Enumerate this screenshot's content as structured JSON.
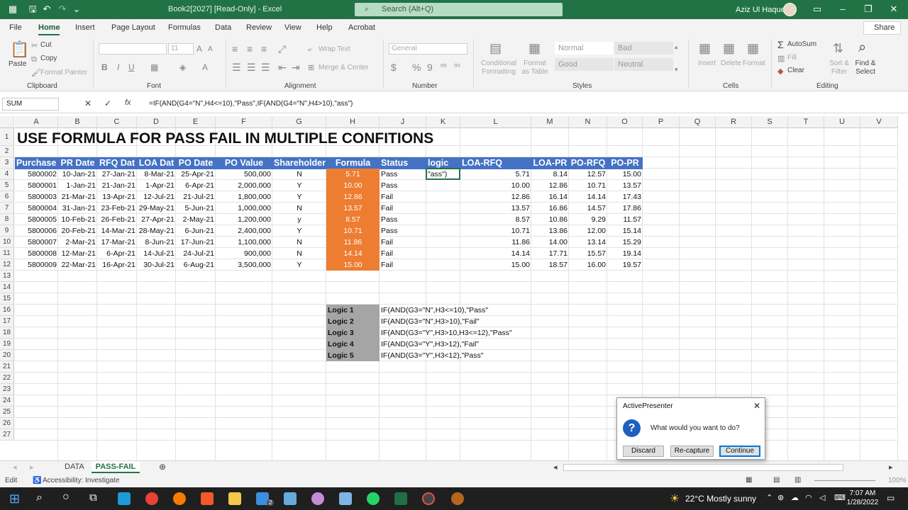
{
  "window": {
    "title": "Book2[2027]  [Read-Only]  -  Excel",
    "search_placeholder": "Search (Alt+Q)",
    "user": "Aziz Ul Haque"
  },
  "tabs": [
    "File",
    "Home",
    "Insert",
    "Page Layout",
    "Formulas",
    "Data",
    "Review",
    "View",
    "Help",
    "Acrobat"
  ],
  "share_label": "Share",
  "ribbon": {
    "clipboard": {
      "paste": "Paste",
      "cut": "Cut",
      "copy": "Copy",
      "format_painter": "Format Painter",
      "group": "Clipboard"
    },
    "font": {
      "size": "11",
      "bold": "B",
      "italic": "I",
      "underline": "U",
      "group": "Font"
    },
    "alignment": {
      "wrap": "Wrap Text",
      "merge": "Merge & Center",
      "group": "Alignment"
    },
    "number": {
      "format": "General",
      "currency": "$",
      "percent": "%",
      "comma": "9",
      "group": "Number"
    },
    "styles": {
      "conditional": "Conditional Formatting",
      "format_table": "Format as Table",
      "normal": "Normal",
      "bad": "Bad",
      "good": "Good",
      "neutral": "Neutral",
      "group": "Styles"
    },
    "cells": {
      "insert": "Insert",
      "delete": "Delete",
      "format": "Format",
      "group": "Cells"
    },
    "editing": {
      "autosum": "AutoSum",
      "fill": "Fill",
      "clear": "Clear",
      "sort": "Sort & Filter",
      "find": "Find & Select",
      "group": "Editing"
    }
  },
  "formula_bar": {
    "name_box": "SUM",
    "cancel": "✕",
    "enter": "✓",
    "fx": "fx",
    "formula": "=IF(AND(G4=\"N\",H4<=10),\"Pass\",IF(AND(G4=\"N\",H4>10),\"ass\")"
  },
  "columns": [
    "A",
    "B",
    "C",
    "D",
    "E",
    "F",
    "G",
    "H",
    "J",
    "K",
    "L",
    "M",
    "N",
    "O",
    "P",
    "Q",
    "R",
    "S",
    "T",
    "U",
    "V"
  ],
  "rows": [
    "1",
    "2",
    "3",
    "4",
    "5",
    "6",
    "7",
    "8",
    "9",
    "10",
    "11",
    "12",
    "13",
    "14",
    "15",
    "16",
    "17",
    "18",
    "19",
    "20",
    "21",
    "22",
    "23",
    "24",
    "25",
    "26",
    "27"
  ],
  "sheet_title": "USE FORMULA FOR PASS FAIL IN MULTIPLE CONFITIONS",
  "table_headers": [
    "Purchase",
    "PR Date",
    "RFQ Dat",
    "LOA Dat",
    "PO Date",
    "PO Value",
    "Shareholder",
    "Formula",
    "Status",
    "logic",
    "LOA-RFQ",
    "LOA-PR",
    "PO-RFQ",
    "PO-PR"
  ],
  "table_rows": [
    [
      "5800002",
      "10-Jan-21",
      "27-Jan-21",
      "8-Mar-21",
      "25-Apr-21",
      "500,000",
      "N",
      "5.71",
      "Pass",
      "\"ass\")",
      "5.71",
      "8.14",
      "12.57",
      "15.00"
    ],
    [
      "5800001",
      "1-Jan-21",
      "21-Jan-21",
      "1-Apr-21",
      "6-Apr-21",
      "2,000,000",
      "Y",
      "10.00",
      "Pass",
      "",
      "10.00",
      "12.86",
      "10.71",
      "13.57"
    ],
    [
      "5800003",
      "21-Mar-21",
      "13-Apr-21",
      "12-Jul-21",
      "21-Jul-21",
      "1,800,000",
      "Y",
      "12.86",
      "Fail",
      "",
      "12.86",
      "16.14",
      "14.14",
      "17.43"
    ],
    [
      "5800004",
      "31-Jan-21",
      "23-Feb-21",
      "29-May-21",
      "5-Jun-21",
      "1,000,000",
      "N",
      "13.57",
      "Fail",
      "",
      "13.57",
      "16.86",
      "14.57",
      "17.86"
    ],
    [
      "5800005",
      "10-Feb-21",
      "26-Feb-21",
      "27-Apr-21",
      "2-May-21",
      "1,200,000",
      "y",
      "8.57",
      "Pass",
      "",
      "8.57",
      "10.86",
      "9.29",
      "11.57"
    ],
    [
      "5800006",
      "20-Feb-21",
      "14-Mar-21",
      "28-May-21",
      "6-Jun-21",
      "2,400,000",
      "Y",
      "10.71",
      "Pass",
      "",
      "10.71",
      "13.86",
      "12.00",
      "15.14"
    ],
    [
      "5800007",
      "2-Mar-21",
      "17-Mar-21",
      "8-Jun-21",
      "17-Jun-21",
      "1,100,000",
      "N",
      "11.86",
      "Fail",
      "",
      "11.86",
      "14.00",
      "13.14",
      "15.29"
    ],
    [
      "5800008",
      "12-Mar-21",
      "6-Apr-21",
      "14-Jul-21",
      "24-Jul-21",
      "900,000",
      "N",
      "14.14",
      "Fail",
      "",
      "14.14",
      "17.71",
      "15.57",
      "19.14"
    ],
    [
      "5800009",
      "22-Mar-21",
      "16-Apr-21",
      "30-Jul-21",
      "6-Aug-21",
      "3,500,000",
      "Y",
      "15.00",
      "Fail",
      "",
      "15.00",
      "18.57",
      "16.00",
      "19.57"
    ]
  ],
  "logic": [
    {
      "label": "Logic 1",
      "text": "IF(AND(G3=\"N\",H3<=10),\"Pass\""
    },
    {
      "label": "Logic 2",
      "text": "IF(AND(G3=\"N\",H3>10),\"Fail\""
    },
    {
      "label": "Logic 3",
      "text": "IF(AND(G3=\"Y\",H3>10,H3<=12),\"Pass\""
    },
    {
      "label": "Logic 4",
      "text": "IF(AND(G3=\"Y\",H3>12),\"Fail\""
    },
    {
      "label": "Logic 5",
      "text": "IF(AND(G3=\"Y\",H3<12),\"Pass\""
    }
  ],
  "sheets": {
    "sheet1": "DATA",
    "sheet2": "PASS-FAIL"
  },
  "status": {
    "mode": "Edit",
    "accessibility": "Accessibility: Investigate",
    "zoom": "100%"
  },
  "dialog": {
    "title": "ActivePresenter",
    "message": "What would you want to do?",
    "discard": "Discard",
    "recapture": "Re-capture",
    "continue": "Continue"
  },
  "taskbar": {
    "weather": "22°C  Mostly sunny",
    "time": "7:07 AM",
    "date": "1/28/2022",
    "badge": "2"
  },
  "colors": {
    "excel_green": "#217346",
    "header_blue": "#4472c4",
    "formula_orange": "#ed7d31",
    "logic_grey": "#a5a5a5"
  }
}
